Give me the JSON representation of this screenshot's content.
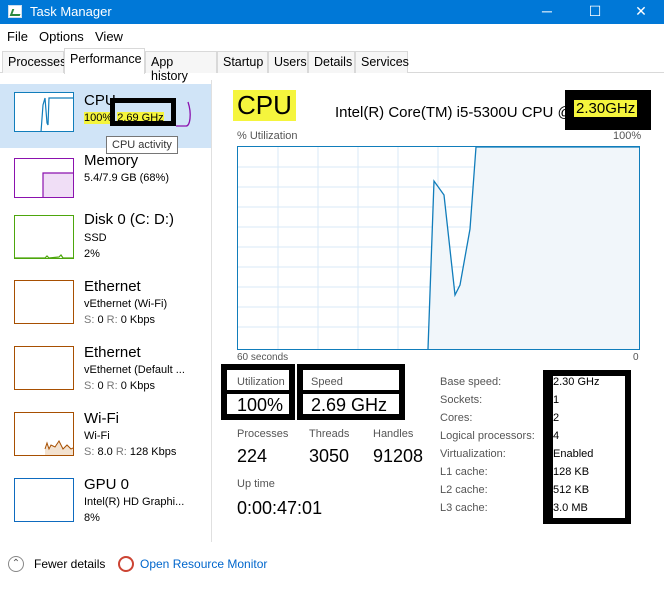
{
  "window": {
    "title": "Task Manager",
    "min": "─",
    "max": "☐",
    "close": "✕"
  },
  "menu": [
    "File",
    "Options",
    "View"
  ],
  "tabs": [
    "Processes",
    "Performance",
    "App history",
    "Startup",
    "Users",
    "Details",
    "Services"
  ],
  "sidebar": {
    "cpu": {
      "name": "CPU",
      "sub1a": "100%",
      "sub1b": "2.69 GHz"
    },
    "tooltip": "CPU activity",
    "memory": {
      "name": "Memory",
      "sub1": "5.4/7.9 GB (68%)"
    },
    "disk": {
      "name": "Disk 0 (C: D:)",
      "sub1": "SSD",
      "sub2": "2%"
    },
    "eth1": {
      "name": "Ethernet",
      "sub1": "vEthernet (Wi-Fi)",
      "sub2a": "S:",
      "sub2b": "0",
      "sub2c": "R:",
      "sub2d": "0 Kbps"
    },
    "eth2": {
      "name": "Ethernet",
      "sub1": "vEthernet (Default ...",
      "sub2a": "S:",
      "sub2b": "0",
      "sub2c": "R:",
      "sub2d": "0 Kbps"
    },
    "wifi": {
      "name": "Wi-Fi",
      "sub1": "Wi-Fi",
      "sub2a": "S:",
      "sub2b": "8.0",
      "sub2c": "R:",
      "sub2d": "128 Kbps"
    },
    "gpu": {
      "name": "GPU 0",
      "sub1": "Intel(R) HD Graphi...",
      "sub2": "8%"
    }
  },
  "main": {
    "title": "CPU",
    "model_prefix": "Intel(R) Core(TM) i5-5300U CPU @",
    "model_speed": "2.30GHz",
    "graph_label": "% Utilization",
    "graph_max": "100%",
    "graph_time": "60 seconds",
    "graph_min": "0",
    "utilization_label": "Utilization",
    "utilization_value": "100%",
    "speed_label": "Speed",
    "speed_value": "2.69 GHz",
    "processes_label": "Processes",
    "processes_value": "224",
    "threads_label": "Threads",
    "threads_value": "3050",
    "handles_label": "Handles",
    "handles_value": "91208",
    "uptime_label": "Up time",
    "uptime_value": "0:00:47:01",
    "specs": [
      {
        "k": "Base speed:",
        "v": "2.30 GHz"
      },
      {
        "k": "Sockets:",
        "v": "1"
      },
      {
        "k": "Cores:",
        "v": "2"
      },
      {
        "k": "Logical processors:",
        "v": "4"
      },
      {
        "k": "Virtualization:",
        "v": "Enabled"
      },
      {
        "k": "L1 cache:",
        "v": "128 KB"
      },
      {
        "k": "L2 cache:",
        "v": "512 KB"
      },
      {
        "k": "L3 cache:",
        "v": "3.0 MB"
      }
    ]
  },
  "footer": {
    "fewer": "Fewer details",
    "monitor": "Open Resource Monitor"
  },
  "colors": {
    "titlebar": "#0078d7",
    "cpu_line": "#117dbb",
    "memory": "#8b12ae",
    "disk": "#4da60c",
    "ethernet": "#a74f01",
    "gpu": "#0e6bbf",
    "highlight": "#f5f53d"
  }
}
